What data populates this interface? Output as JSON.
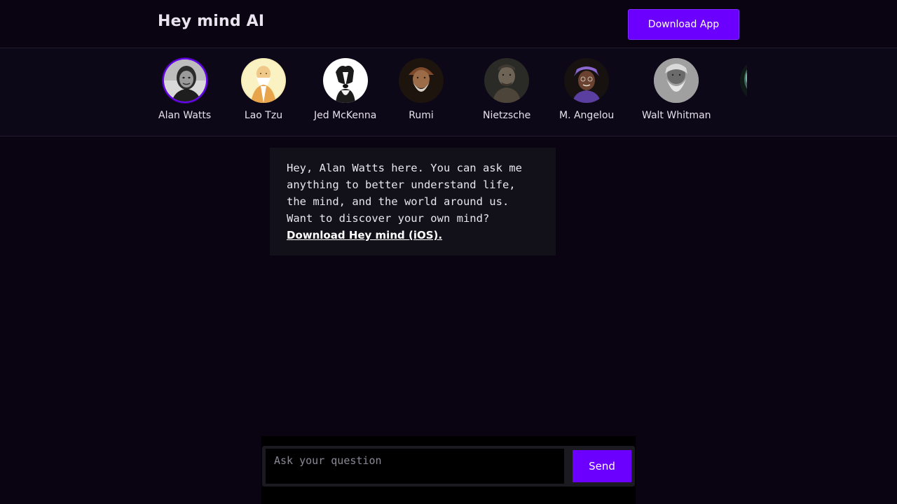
{
  "header": {
    "brand": "Hey mind AI",
    "download_label": "Download App"
  },
  "personas": [
    {
      "name": "Alan Watts",
      "selected": true
    },
    {
      "name": "Lao Tzu"
    },
    {
      "name": "Jed McKenna"
    },
    {
      "name": "Rumi"
    },
    {
      "name": "Nietzsche"
    },
    {
      "name": "M. Angelou"
    },
    {
      "name": "Walt Whitman"
    }
  ],
  "message": {
    "lines": [
      "Hey, Alan Watts here. You can ask me",
      "anything to better understand life,",
      "the mind, and the world around us.",
      "Want to discover your own mind?"
    ],
    "link_text": "Download Hey mind (iOS)."
  },
  "composer": {
    "placeholder": "Ask your question",
    "send_label": "Send"
  },
  "colors": {
    "accent": "#6b00ff",
    "background": "#0a0412",
    "bubble": "#121019"
  }
}
